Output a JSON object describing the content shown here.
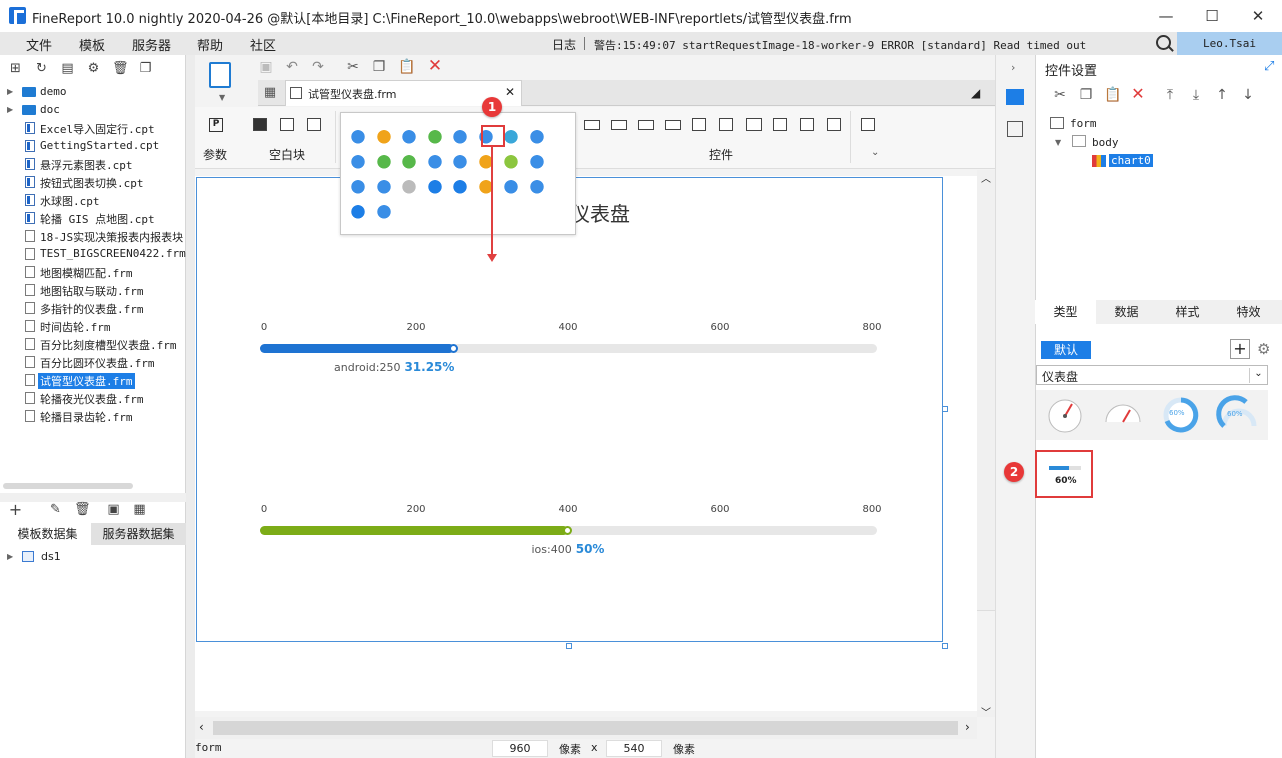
{
  "titlebar": {
    "title": "FineReport 10.0 nightly 2020-04-26 @默认[本地目录]    C:\\FineReport_10.0\\webapps\\webroot\\WEB-INF\\reportlets/试管型仪表盘.frm",
    "minimize": "—",
    "maximize": "☐",
    "close": "✕"
  },
  "menubar": {
    "items": [
      "文件",
      "模板",
      "服务器",
      "帮助",
      "社区"
    ],
    "log_label": "日志",
    "log_message": "警告:15:49:07 startRequestImage-18-worker-9 ERROR [standard] Read timed out",
    "user": "Leo.Tsai"
  },
  "left_panel": {
    "tree": [
      {
        "label": "demo",
        "kind": "folder"
      },
      {
        "label": "doc",
        "kind": "folder"
      },
      {
        "label": "Excel导入固定行.cpt",
        "kind": "cpt"
      },
      {
        "label": "GettingStarted.cpt",
        "kind": "cpt"
      },
      {
        "label": "悬浮元素图表.cpt",
        "kind": "cpt"
      },
      {
        "label": "按钮式图表切换.cpt",
        "kind": "cpt"
      },
      {
        "label": "水球图.cpt",
        "kind": "cpt"
      },
      {
        "label": "轮播 GIS 点地图.cpt",
        "kind": "cpt"
      },
      {
        "label": "18-JS实现决策报表内报表块",
        "kind": "frm"
      },
      {
        "label": "TEST_BIGSCREEN0422.frm",
        "kind": "frm"
      },
      {
        "label": "地图模糊匹配.frm",
        "kind": "frm"
      },
      {
        "label": "地图钻取与联动.frm",
        "kind": "frm"
      },
      {
        "label": "多指针的仪表盘.frm",
        "kind": "frm"
      },
      {
        "label": "时间齿轮.frm",
        "kind": "frm"
      },
      {
        "label": "百分比刻度槽型仪表盘.frm",
        "kind": "frm"
      },
      {
        "label": "百分比圆环仪表盘.frm",
        "kind": "frm"
      },
      {
        "label": "试管型仪表盘.frm",
        "kind": "frm",
        "selected": true
      },
      {
        "label": "轮播夜光仪表盘.frm",
        "kind": "frm"
      },
      {
        "label": "轮播目录齿轮.frm",
        "kind": "frm"
      }
    ],
    "dataset_tabs": [
      "模板数据集",
      "服务器数据集"
    ],
    "dataset": "ds1"
  },
  "editor": {
    "tab_label": "试管型仪表盘.frm",
    "ribbon": {
      "param": "参数",
      "blank": "空白块",
      "widget": "控件"
    },
    "chart_title": "仪表盘",
    "gauges": [
      {
        "ticks": [
          "0",
          "200",
          "400",
          "600",
          "800"
        ],
        "label": "android:250",
        "percent": "31.25%",
        "value": 0.3125,
        "color": "#1e73d2",
        "pct_color": "#2a8ad8"
      },
      {
        "ticks": [
          "0",
          "200",
          "400",
          "600",
          "800"
        ],
        "label": "ios:400",
        "percent": "50%",
        "value": 0.5,
        "color": "#7cac17",
        "pct_color": "#2a8ad8"
      }
    ],
    "status": {
      "name": "form",
      "width": "960",
      "unit1": "像素",
      "x": "x",
      "height": "540",
      "unit2": "像素"
    }
  },
  "popup": {
    "badge": "1"
  },
  "right_panel": {
    "title": "控件设置",
    "tree": {
      "root": "form",
      "body": "body",
      "chart": "chart0"
    },
    "tabs": [
      "类型",
      "数据",
      "样式",
      "特效"
    ],
    "default_btn": "默认",
    "select_value": "仪表盘",
    "thumb_values": [
      "60%",
      "60%"
    ],
    "selected_thumb_value": "60%",
    "badge": "2"
  }
}
